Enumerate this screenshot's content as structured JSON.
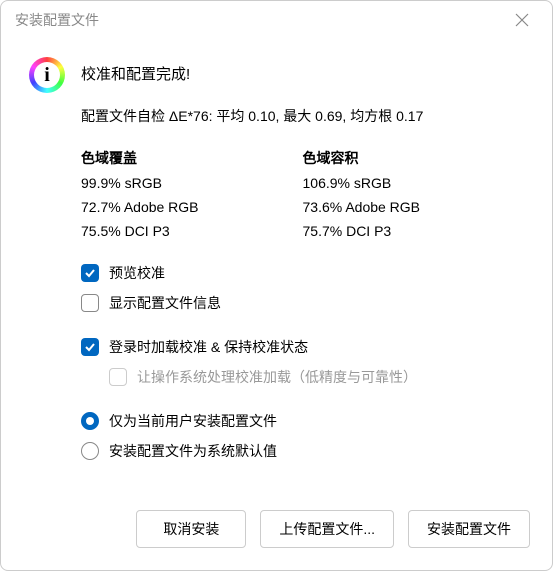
{
  "window": {
    "title": "安装配置文件"
  },
  "heading": "校准和配置完成!",
  "self_check": "配置文件自检 ΔE*76: 平均 0.10, 最大 0.69, 均方根 0.17",
  "gamut": {
    "coverage": {
      "heading": "色域覆盖",
      "srgb": "99.9% sRGB",
      "adobergb": "72.7% Adobe RGB",
      "dcip3": "75.5% DCI P3"
    },
    "volume": {
      "heading": "色域容积",
      "srgb": "106.9% sRGB",
      "adobergb": "73.6% Adobe RGB",
      "dcip3": "75.7% DCI P3"
    }
  },
  "options": {
    "preview": "预览校准",
    "show_info": "显示配置文件信息",
    "load_and_keep": "登录时加载校准 & 保持校准状态",
    "os_handle": "让操作系统处理校准加载（低精度与可靠性）",
    "install_user": "仅为当前用户安装配置文件",
    "install_system": "安装配置文件为系统默认值"
  },
  "buttons": {
    "cancel": "取消安装",
    "upload": "上传配置文件...",
    "install": "安装配置文件"
  }
}
